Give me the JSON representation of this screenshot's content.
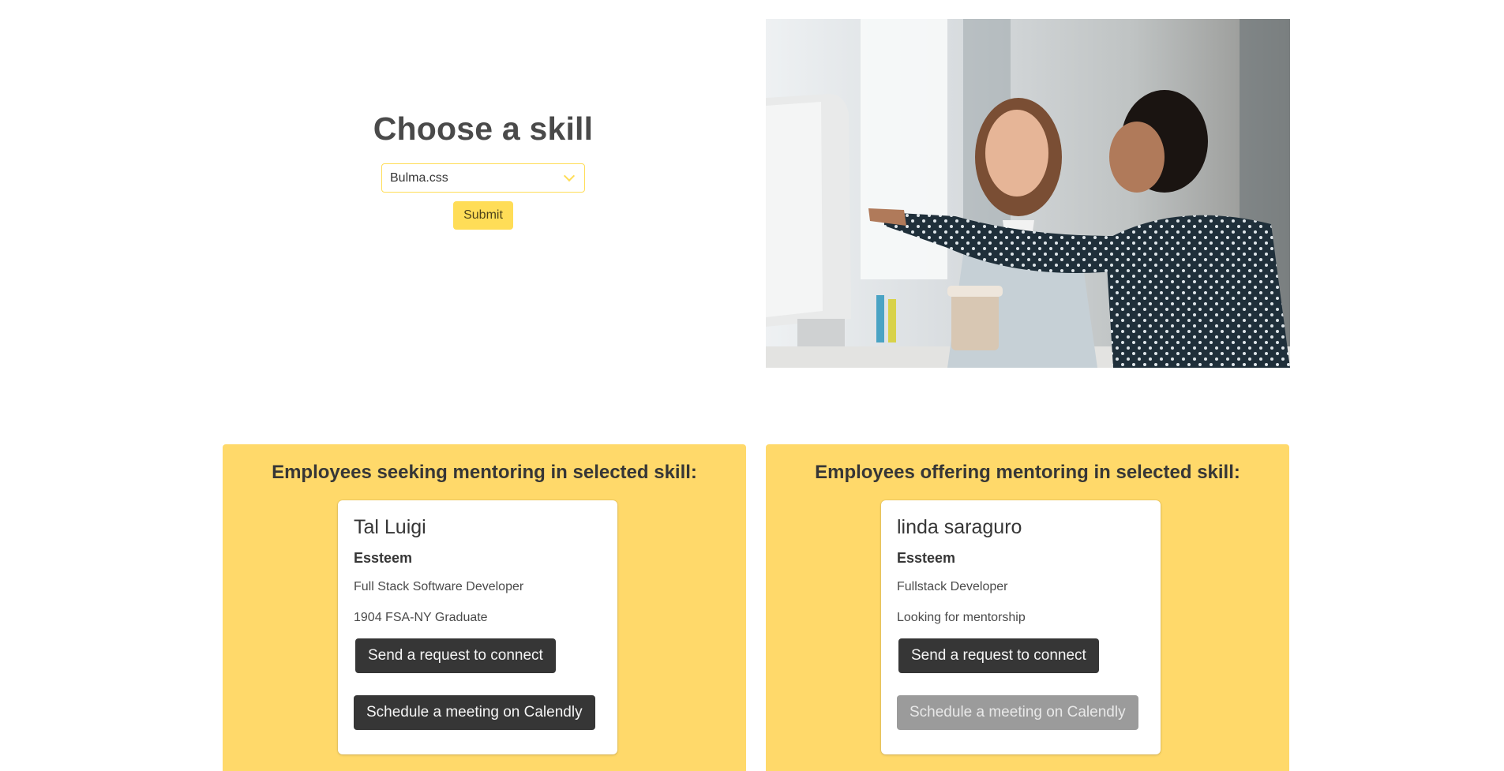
{
  "skill_section": {
    "title": "Choose a skill",
    "selected_skill": "Bulma.css",
    "submit_label": "Submit"
  },
  "seeking_panel": {
    "title": "Employees seeking mentoring in selected skill:",
    "card": {
      "name": "Tal Luigi",
      "company": "Essteem",
      "role": "Full Stack Software Developer",
      "note": "1904 FSA-NY Graduate",
      "connect_label": "Send a request to connect",
      "schedule_label": "Schedule a meeting on Calendly"
    }
  },
  "offering_panel": {
    "title": "Employees offering mentoring in selected skill:",
    "card": {
      "name": "linda saraguro",
      "company": "Essteem",
      "role": "Fullstack Developer",
      "note": "Looking for mentorship",
      "connect_label": "Send a request to connect",
      "schedule_label": "Schedule a meeting on Calendly"
    }
  },
  "colors": {
    "accent": "#ffdd57",
    "panel_bg": "#ffd96a",
    "dark_button": "#363636",
    "disabled_button": "#9b9b9b"
  },
  "icons": {
    "select": "chevron-down-icon"
  }
}
